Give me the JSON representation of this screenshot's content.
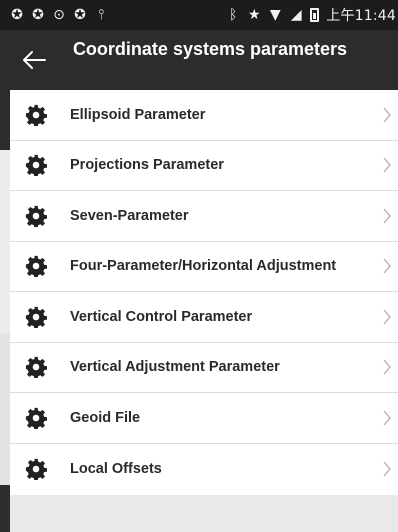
{
  "status_bar": {
    "left_icons": [
      "sync-icon",
      "sync-icon",
      "alarm-icon",
      "sync-icon",
      "usb-icon"
    ],
    "right_icons": [
      "bluetooth-icon",
      "star-icon",
      "wifi-icon",
      "signal-icon",
      "battery-icon"
    ],
    "time": "上午11:44"
  },
  "app_bar": {
    "back_icon": "back-arrow-icon",
    "title": "Coordinate systems parameters"
  },
  "menu": {
    "items": [
      {
        "label": "Ellipsoid Parameter",
        "icon": "gear-icon"
      },
      {
        "label": "Projections Parameter",
        "icon": "gear-icon"
      },
      {
        "label": "Seven-Parameter",
        "icon": "gear-icon"
      },
      {
        "label": "Four-Parameter/Horizontal Adjustment",
        "icon": "gear-icon"
      },
      {
        "label": "Vertical Control Parameter",
        "icon": "gear-icon"
      },
      {
        "label": "Vertical Adjustment Parameter",
        "icon": "gear-icon"
      },
      {
        "label": "Geoid File",
        "icon": "gear-icon"
      },
      {
        "label": "Local Offsets",
        "icon": "gear-icon"
      }
    ]
  },
  "colors": {
    "status_bar": "#1c1c1c",
    "app_bar": "#2c2c2c",
    "list_background": "#ffffff",
    "divider": "#dcdcdc",
    "label_text": "#2a2a2a",
    "footer": "#e9e9e9"
  }
}
